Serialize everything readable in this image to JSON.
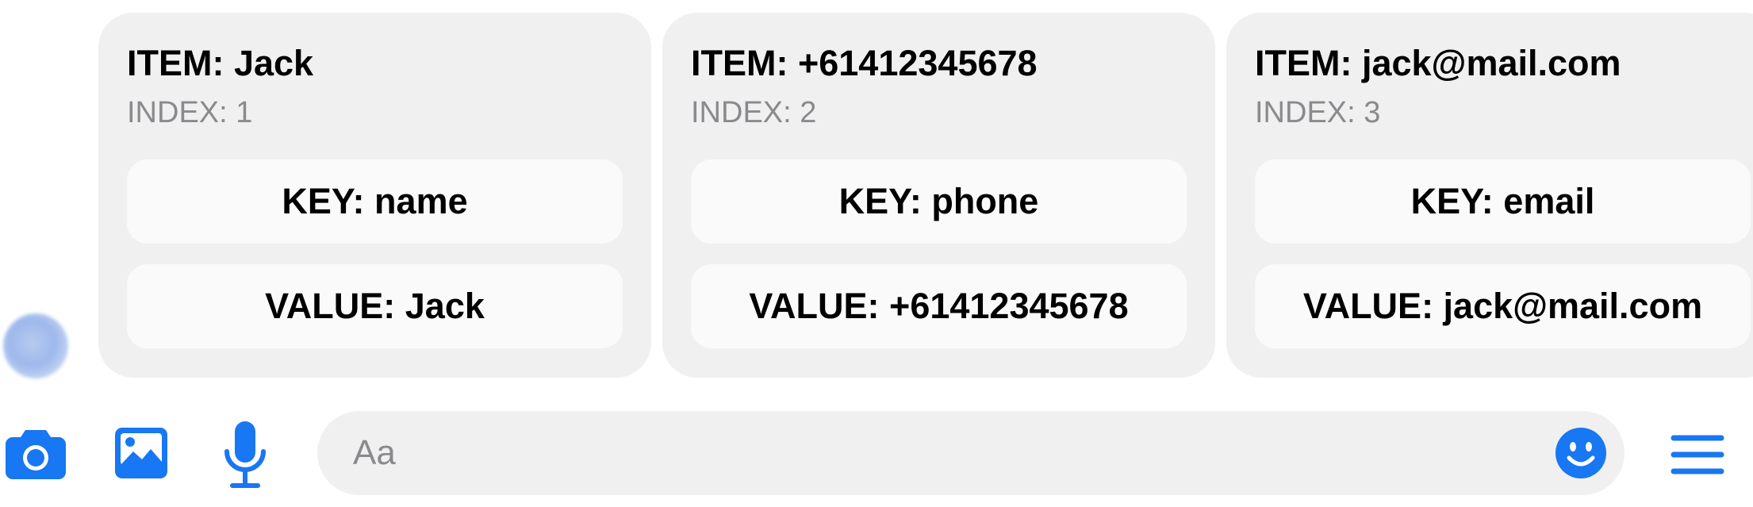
{
  "colors": {
    "accent": "#1877F2",
    "card_bg": "#F0F0F0",
    "pill_bg": "#FAFAFA",
    "muted_text": "#8A8A8E"
  },
  "cards": [
    {
      "item": "ITEM: Jack",
      "index": "INDEX: 1",
      "key": "KEY: name",
      "value": "VALUE: Jack"
    },
    {
      "item": "ITEM: +61412345678",
      "index": "INDEX: 2",
      "key": "KEY: phone",
      "value": "VALUE: +61412345678"
    },
    {
      "item": "ITEM: jack@mail.com",
      "index": "INDEX: 3",
      "key": "KEY: email",
      "value": "VALUE: jack@mail.com"
    }
  ],
  "composer": {
    "placeholder": "Aa",
    "icons": [
      "camera-icon",
      "image-icon",
      "microphone-icon",
      "emoji-icon",
      "menu-icon"
    ]
  }
}
